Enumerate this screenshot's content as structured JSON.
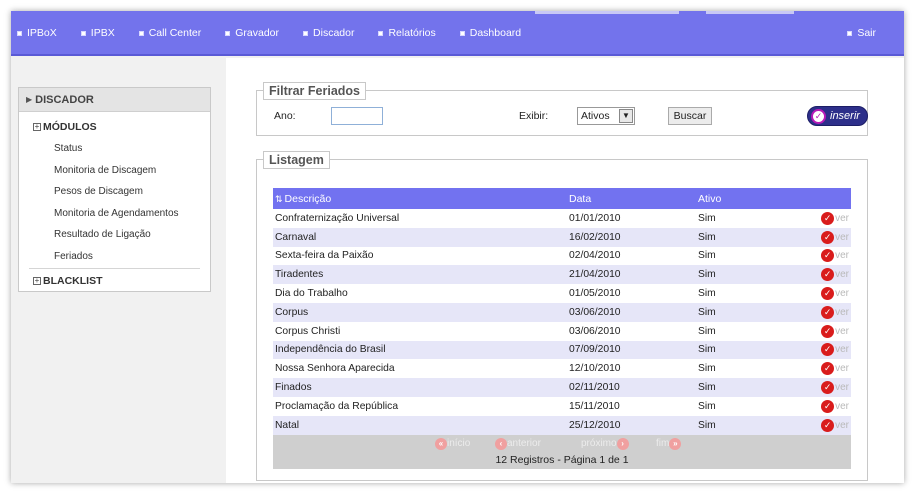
{
  "nav": {
    "items": [
      {
        "label": "IPBoX"
      },
      {
        "label": "IPBX"
      },
      {
        "label": "Call Center"
      },
      {
        "label": "Gravador"
      },
      {
        "label": "Discador"
      },
      {
        "label": "Relatórios"
      },
      {
        "label": "Dashboard"
      }
    ],
    "logout_label": "Sair"
  },
  "sidebar": {
    "header": "DISCADOR",
    "group1": "MÓDULOS",
    "links": [
      "Status",
      "Monitoria de Discagem",
      "Pesos de Discagem",
      "Monitoria de Agendamentos",
      "Resultado de Ligação",
      "Feriados"
    ],
    "group2": "BLACKLIST",
    "expand_glyph": "+"
  },
  "filter": {
    "legend": "Filtrar Feriados",
    "year_label": "Ano:",
    "year_value": "",
    "show_label": "Exibir:",
    "show_value": "Ativos",
    "search_label": "Buscar",
    "insert_label": "inserir"
  },
  "listing": {
    "legend": "Listagem",
    "columns": {
      "description": "Descrição",
      "date": "Data",
      "active": "Ativo"
    },
    "view_label": "ver",
    "rows": [
      {
        "description": "Confraternização Universal",
        "date": "01/01/2010",
        "active": "Sim"
      },
      {
        "description": "Carnaval",
        "date": "16/02/2010",
        "active": "Sim"
      },
      {
        "description": "Sexta-feira da Paixão",
        "date": "02/04/2010",
        "active": "Sim"
      },
      {
        "description": "Tiradentes",
        "date": "21/04/2010",
        "active": "Sim"
      },
      {
        "description": "Dia do Trabalho",
        "date": "01/05/2010",
        "active": "Sim"
      },
      {
        "description": "Corpus",
        "date": "03/06/2010",
        "active": "Sim"
      },
      {
        "description": "Corpus Christi",
        "date": "03/06/2010",
        "active": "Sim"
      },
      {
        "description": "Independência do Brasil",
        "date": "07/09/2010",
        "active": "Sim"
      },
      {
        "description": "Nossa Senhora Aparecida",
        "date": "12/10/2010",
        "active": "Sim"
      },
      {
        "description": "Finados",
        "date": "02/11/2010",
        "active": "Sim"
      },
      {
        "description": "Proclamação da República",
        "date": "15/11/2010",
        "active": "Sim"
      },
      {
        "description": "Natal",
        "date": "25/12/2010",
        "active": "Sim"
      }
    ],
    "pager": {
      "first": "início",
      "prev": "anterior",
      "next": "próximo",
      "last": "fim",
      "status": "12 Registros - Página 1 de 1"
    }
  },
  "colors": {
    "topbar": "#7373ec",
    "table_header": "#7272f0",
    "row_alt": "#e6e6f8",
    "view_icon": "#d91c1c"
  }
}
